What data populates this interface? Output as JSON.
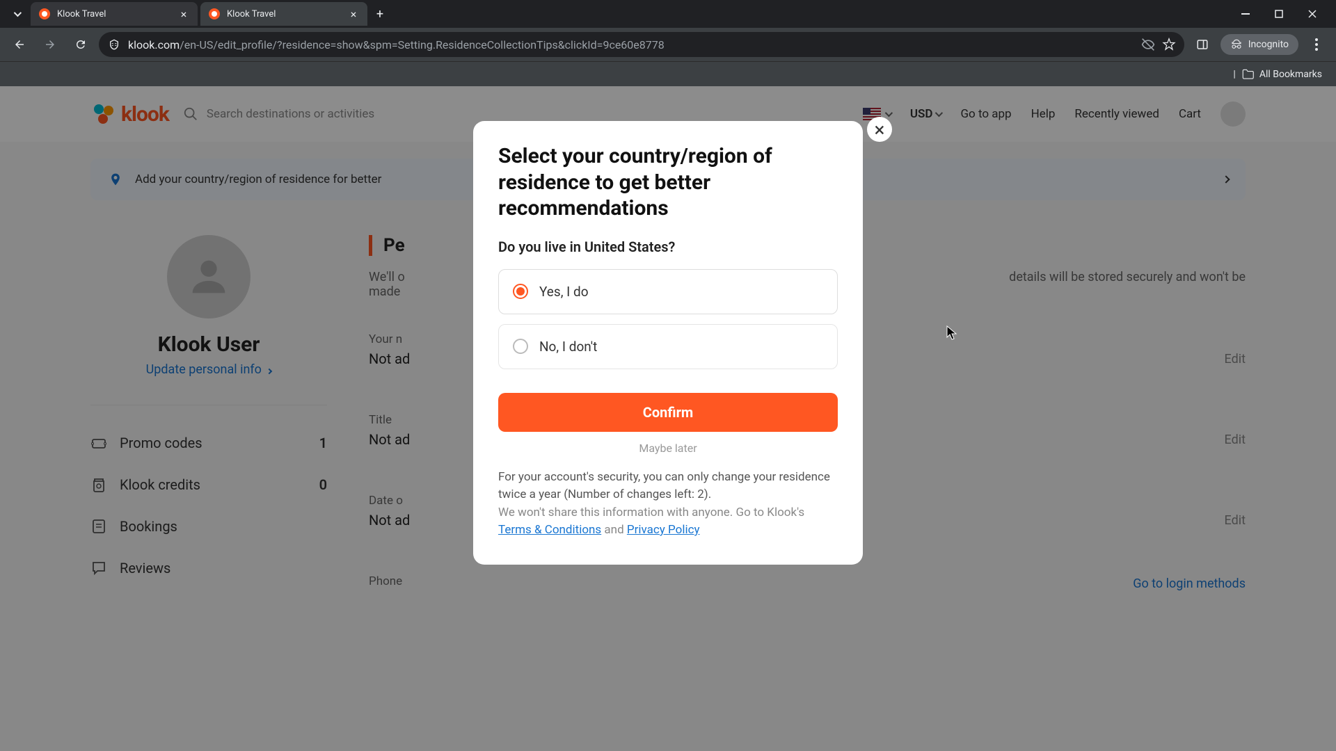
{
  "browser": {
    "tabs": [
      {
        "title": "Klook Travel",
        "active": false
      },
      {
        "title": "Klook Travel",
        "active": true
      }
    ],
    "url_display_host": "klook.com",
    "url_display_path": "/en-US/edit_profile/?residence=show&spm=Setting.ResidenceCollectionTips&clickId=9ce60e8778",
    "incognito_label": "Incognito",
    "bookmarks_label": "All Bookmarks"
  },
  "header": {
    "logo_text": "klook",
    "search_placeholder": "Search destinations or activities",
    "currency": "USD",
    "links": {
      "go_to_app": "Go to app",
      "help": "Help",
      "recently_viewed": "Recently viewed",
      "cart": "Cart"
    }
  },
  "banner": {
    "text": "Add your country/region of residence for better"
  },
  "sidebar": {
    "user_name": "Klook User",
    "update_link": "Update personal info",
    "menu": [
      {
        "icon": "promo",
        "label": "Promo codes",
        "count": "1"
      },
      {
        "icon": "credits",
        "label": "Klook credits",
        "count": "0"
      },
      {
        "icon": "bookings",
        "label": "Bookings",
        "count": ""
      },
      {
        "icon": "reviews",
        "label": "Reviews",
        "count": ""
      }
    ]
  },
  "content": {
    "section_title_visible": "Pe",
    "section_desc_prefix": "We'll o",
    "section_desc_suffix": "details will be stored securely and won't be",
    "section_desc_line2": "made",
    "fields": [
      {
        "label": "Your n",
        "value": "Not ad",
        "edit": "Edit"
      },
      {
        "label": "Title",
        "value": "Not ad",
        "edit": "Edit"
      },
      {
        "label": "Date o",
        "value": "Not ad",
        "edit": "Edit"
      },
      {
        "label": "Phone",
        "value": "",
        "edit": "Go to login methods"
      }
    ]
  },
  "modal": {
    "title": "Select your country/region of residence to get better recommendations",
    "subtitle": "Do you live in United States?",
    "option_yes": "Yes, I do",
    "option_no": "No, I don't",
    "confirm": "Confirm",
    "maybe_later": "Maybe later",
    "footer_line1": "For your account's security, you can only change your residence twice a year (Number of changes left: 2).",
    "footer_line2_pre": "We won't share this information with anyone. Go to Klook's ",
    "footer_terms": "Terms & Conditions",
    "footer_and": " and ",
    "footer_privacy": "Privacy Policy"
  }
}
